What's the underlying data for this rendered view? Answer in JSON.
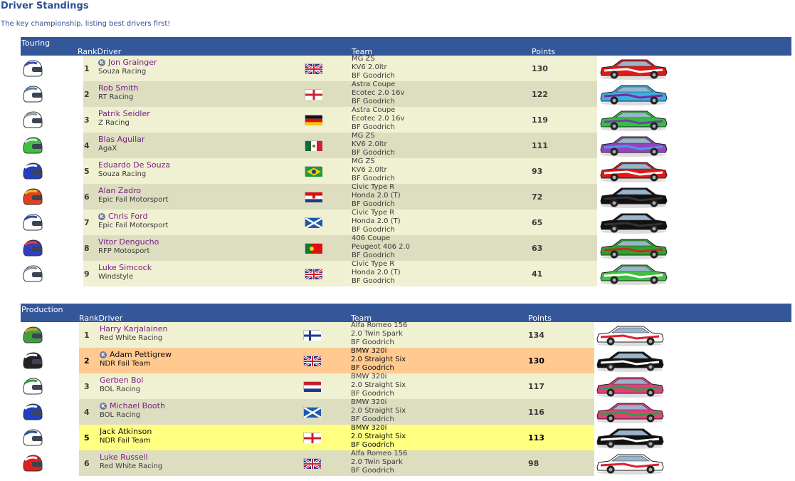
{
  "page": {
    "title": "Driver Standings",
    "subtitle": "The key championship, listing best drivers first!"
  },
  "columns": {
    "rank_driver": "RankDriver",
    "team": "Team",
    "points": "Points"
  },
  "sections": [
    {
      "name": "Touring",
      "rows": [
        {
          "rank": "1",
          "badge": true,
          "driver": "Jon Grainger",
          "team": "Souza Racing",
          "flag": "gb",
          "car": [
            "MG ZS",
            "KV6 2.0ltr",
            "BF Goodrich"
          ],
          "points": "130",
          "highlight": "",
          "helmet_colors": [
            "#ffffff",
            "#3a4fbf"
          ],
          "livery_colors": [
            "#e01818",
            "#ffffff"
          ]
        },
        {
          "rank": "2",
          "badge": false,
          "driver": "Rob Smith",
          "team": "RT Racing",
          "flag": "en",
          "car": [
            "Astra Coupe",
            "Ecotec 2.0 16v",
            "BF Goodrich"
          ],
          "points": "122",
          "highlight": "",
          "helmet_colors": [
            "#ffffff",
            "#5a7fa0"
          ],
          "livery_colors": [
            "#3ab0e0",
            "#7a2aa0"
          ]
        },
        {
          "rank": "3",
          "badge": false,
          "driver": "Patrik Seidler",
          "team": "Z Racing",
          "flag": "de",
          "car": [
            "Astra Coupe",
            "Ecotec 2.0 16v",
            "BF Goodrich"
          ],
          "points": "119",
          "highlight": "",
          "helmet_colors": [
            "#ffffff",
            "#8899aa"
          ],
          "livery_colors": [
            "#30c040",
            "#7a3ab0"
          ]
        },
        {
          "rank": "4",
          "badge": false,
          "driver": "Blas Aguilar",
          "team": "AgaX",
          "flag": "mx",
          "car": [
            "MG ZS",
            "KV6 2.0ltr",
            "BF Goodrich"
          ],
          "points": "111",
          "highlight": "",
          "helmet_colors": [
            "#40c040",
            "#e0e0e0"
          ],
          "livery_colors": [
            "#9a40c0",
            "#40a0e0"
          ]
        },
        {
          "rank": "5",
          "badge": false,
          "driver": "Eduardo De Souza",
          "team": "Souza Racing",
          "flag": "br",
          "car": [
            "MG ZS",
            "KV6 2.0ltr",
            "BF Goodrich"
          ],
          "points": "93",
          "highlight": "",
          "helmet_colors": [
            "#2040c0",
            "#ffffff"
          ],
          "livery_colors": [
            "#e01818",
            "#ffffff"
          ]
        },
        {
          "rank": "6",
          "badge": false,
          "driver": "Alan Zadro",
          "team": "Epic Fail Motorsport",
          "flag": "hr",
          "car": [
            "Civic Type R",
            "Honda 2.0 (T)",
            "BF Goodrich"
          ],
          "points": "72",
          "highlight": "",
          "helmet_colors": [
            "#e04020",
            "#f0c020"
          ],
          "livery_colors": [
            "#111111",
            "#333333"
          ]
        },
        {
          "rank": "7",
          "badge": true,
          "driver": "Chris Ford",
          "team": "Epic Fail Motorsport",
          "flag": "sc",
          "car": [
            "Civic Type R",
            "Honda 2.0 (T)",
            "BF Goodrich"
          ],
          "points": "65",
          "highlight": "",
          "helmet_colors": [
            "#ffffff",
            "#3050a0"
          ],
          "livery_colors": [
            "#111111",
            "#333333"
          ]
        },
        {
          "rank": "8",
          "badge": false,
          "driver": "Vitor Dengucho",
          "team": "RFP Motosport",
          "flag": "pt",
          "car": [
            "406 Coupe",
            "Peugeot 406 2.0",
            "BF Goodrich"
          ],
          "points": "63",
          "highlight": "",
          "helmet_colors": [
            "#3040c0",
            "#e04040"
          ],
          "livery_colors": [
            "#30a030",
            "#c03020"
          ]
        },
        {
          "rank": "9",
          "badge": false,
          "driver": "Luke Simcock",
          "team": "Windstyle",
          "flag": "gb",
          "car": [
            "Civic Type R",
            "Honda 2.0 (T)",
            "BF Goodrich"
          ],
          "points": "41",
          "highlight": "",
          "helmet_colors": [
            "#ffffff",
            "#8899aa"
          ],
          "livery_colors": [
            "#40c040",
            "#ffffff"
          ]
        }
      ]
    },
    {
      "name": "Production",
      "rows": [
        {
          "rank": "1",
          "badge": false,
          "driver": "Harry Karjalainen",
          "team": "Red White Racing",
          "flag": "fi",
          "car": [
            "Alfa Romeo 156",
            "2.0 Twin Spark",
            "BF Goodrich"
          ],
          "points": "134",
          "highlight": "",
          "helmet_colors": [
            "#40a040",
            "#e0a020"
          ],
          "livery_colors": [
            "#ffffff",
            "#e02030"
          ]
        },
        {
          "rank": "2",
          "badge": true,
          "driver": "Adam Pettigrew",
          "team": "NDR Fail Team",
          "flag": "gb",
          "car": [
            "BMW 320i",
            "2.0 Straight Six",
            "BF Goodrich"
          ],
          "points": "130",
          "highlight": "orange",
          "helmet_colors": [
            "#222222",
            "#ffffff"
          ],
          "livery_colors": [
            "#111111",
            "#ffffff"
          ]
        },
        {
          "rank": "3",
          "badge": false,
          "driver": "Gerben Bol",
          "team": "BOL Racing",
          "flag": "nl",
          "car": [
            "BMW 320i",
            "2.0 Straight Six",
            "BF Goodrich"
          ],
          "points": "117",
          "highlight": "",
          "helmet_colors": [
            "#ffffff",
            "#30a040"
          ],
          "livery_colors": [
            "#e04080",
            "#30a040"
          ]
        },
        {
          "rank": "4",
          "badge": true,
          "driver": "Michael Booth",
          "team": "BOL Racing",
          "flag": "sc",
          "car": [
            "BMW 320i",
            "2.0 Straight Six",
            "BF Goodrich"
          ],
          "points": "116",
          "highlight": "",
          "helmet_colors": [
            "#2040c0",
            "#ffffff"
          ],
          "livery_colors": [
            "#e04080",
            "#30a040"
          ]
        },
        {
          "rank": "5",
          "badge": false,
          "driver": "Jack Atkinson",
          "team": "NDR Fail Team",
          "flag": "en",
          "car": [
            "BMW 320i",
            "2.0 Straight Six",
            "BF Goodrich"
          ],
          "points": "113",
          "highlight": "yellow",
          "helmet_colors": [
            "#ffffff",
            "#3050a0"
          ],
          "livery_colors": [
            "#111111",
            "#ffffff"
          ]
        },
        {
          "rank": "6",
          "badge": false,
          "driver": "Luke Russell",
          "team": "Red White Racing",
          "flag": "gb",
          "car": [
            "Alfa Romeo 156",
            "2.0 Twin Spark",
            "BF Goodrich"
          ],
          "points": "98",
          "highlight": "",
          "helmet_colors": [
            "#e02020",
            "#ffffff"
          ],
          "livery_colors": [
            "#ffffff",
            "#e02030"
          ]
        }
      ]
    }
  ],
  "badge_letter": "K",
  "row_colors": [
    "#f0f0d2",
    "#ddddc0"
  ]
}
